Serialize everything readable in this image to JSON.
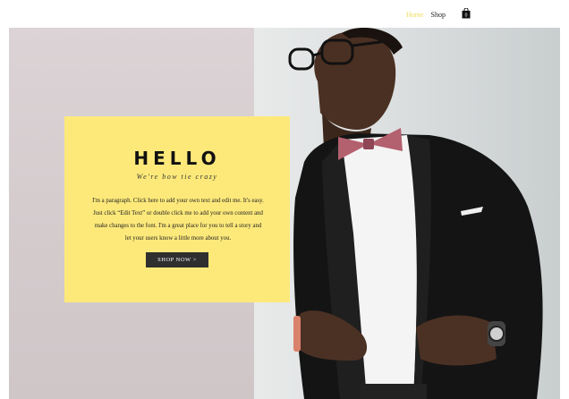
{
  "nav": {
    "items": [
      {
        "label": "Home",
        "active": true
      },
      {
        "label": "Shop",
        "active": false
      }
    ],
    "cart_icon": "shopping-bag-icon",
    "cart_count": "0"
  },
  "hero": {
    "title": "HELLO",
    "subtitle": "We're bow tie crazy",
    "paragraph": "I'm a paragraph. Click here to add your own text and edit me. It's easy. Just click “Edit Text” or double click me to add your own content and make changes to the font. I'm a great place for you to tell a story and let your users know a little more about you.",
    "cta_label": "SHOP NOW >"
  },
  "colors": {
    "accent": "#fde97a",
    "nav_active": "#f2dc5d",
    "button": "#2f2f2f",
    "bowtie": "#b3606f"
  }
}
